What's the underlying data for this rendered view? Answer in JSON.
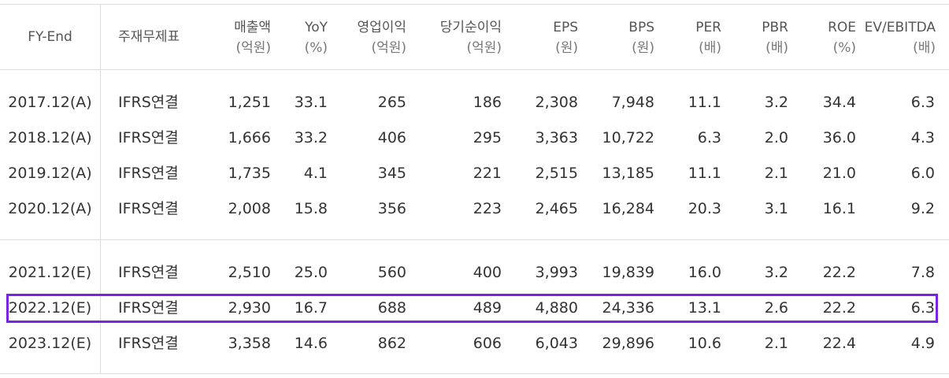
{
  "table": {
    "headers": [
      {
        "label": "FY-End",
        "unit": ""
      },
      {
        "label": "주재무제표",
        "unit": ""
      },
      {
        "label": "매출액",
        "unit": "(억원)"
      },
      {
        "label": "YoY",
        "unit": "(%)"
      },
      {
        "label": "영업이익",
        "unit": "(억원)"
      },
      {
        "label": "당기순이익",
        "unit": "(억원)"
      },
      {
        "label": "EPS",
        "unit": "(원)"
      },
      {
        "label": "BPS",
        "unit": "(원)"
      },
      {
        "label": "PER",
        "unit": "(배)"
      },
      {
        "label": "PBR",
        "unit": "(배)"
      },
      {
        "label": "ROE",
        "unit": "(%)"
      },
      {
        "label": "EV/EBITDA",
        "unit": "(배)"
      }
    ],
    "rows": [
      [
        "2017.12(A)",
        "IFRS연결",
        "1,251",
        "33.1",
        "265",
        "186",
        "2,308",
        "7,948",
        "11.1",
        "3.2",
        "34.4",
        "6.3"
      ],
      [
        "2018.12(A)",
        "IFRS연결",
        "1,666",
        "33.2",
        "406",
        "295",
        "3,363",
        "10,722",
        "6.3",
        "2.0",
        "36.0",
        "4.3"
      ],
      [
        "2019.12(A)",
        "IFRS연결",
        "1,735",
        "4.1",
        "345",
        "221",
        "2,515",
        "13,185",
        "11.1",
        "2.1",
        "21.0",
        "6.0"
      ],
      [
        "2020.12(A)",
        "IFRS연결",
        "2,008",
        "15.8",
        "356",
        "223",
        "2,465",
        "16,284",
        "20.3",
        "3.1",
        "16.1",
        "9.2"
      ],
      [
        "2021.12(E)",
        "IFRS연결",
        "2,510",
        "25.0",
        "560",
        "400",
        "3,993",
        "19,839",
        "16.0",
        "3.2",
        "22.2",
        "7.8"
      ],
      [
        "2022.12(E)",
        "IFRS연결",
        "2,930",
        "16.7",
        "688",
        "489",
        "4,880",
        "24,336",
        "13.1",
        "2.6",
        "22.2",
        "6.3"
      ],
      [
        "2023.12(E)",
        "IFRS연결",
        "3,358",
        "14.6",
        "862",
        "606",
        "6,043",
        "29,896",
        "10.6",
        "2.1",
        "22.4",
        "4.9"
      ]
    ],
    "highlight_color": "#7a23e0"
  }
}
